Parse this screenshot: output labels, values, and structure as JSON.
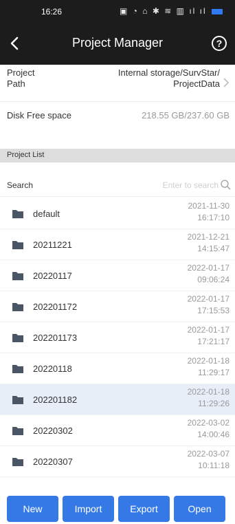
{
  "status_bar": {
    "time": "16:26",
    "icons_text": "▣ ◔ ⌂ ✱ ≋ ▥ ıl ıl"
  },
  "header": {
    "title": "Project Manager",
    "back_icon": "chevron-left-icon",
    "help_icon": "question-circle-icon",
    "help_glyph": "?"
  },
  "project_path": {
    "label_line1": "Project",
    "label_line2": "Path",
    "value_line1": "Internal storage/SurvStar/",
    "value_line2": "ProjectData"
  },
  "disk": {
    "label": "Disk Free space",
    "value": "218.55 GB/237.60 GB"
  },
  "project_list": {
    "header": "Project List"
  },
  "search": {
    "label": "Search",
    "placeholder": "Enter to search"
  },
  "projects": [
    {
      "name": "default",
      "date": "2021-11-30",
      "time": "16:17:10"
    },
    {
      "name": "20211221",
      "date": "2021-12-21",
      "time": "14:15:47"
    },
    {
      "name": "20220117",
      "date": "2022-01-17",
      "time": "09:06:24"
    },
    {
      "name": "202201172",
      "date": "2022-01-17",
      "time": "17:15:53"
    },
    {
      "name": "202201173",
      "date": "2022-01-17",
      "time": "17:21:17"
    },
    {
      "name": "20220118",
      "date": "2022-01-18",
      "time": "11:29:17"
    },
    {
      "name": "202201182",
      "date": "2022-01-18",
      "time": "11:29:26"
    },
    {
      "name": "20220302",
      "date": "2022-03-02",
      "time": "14:00:46"
    },
    {
      "name": "20220307",
      "date": "2022-03-07",
      "time": "10:11:18"
    }
  ],
  "actions": {
    "new": "New",
    "import": "Import",
    "export": "Export",
    "open": "Open"
  },
  "colors": {
    "accent": "#3579e6",
    "header_bg": "#1c1c1c",
    "selected_row": "#e8eef8"
  }
}
